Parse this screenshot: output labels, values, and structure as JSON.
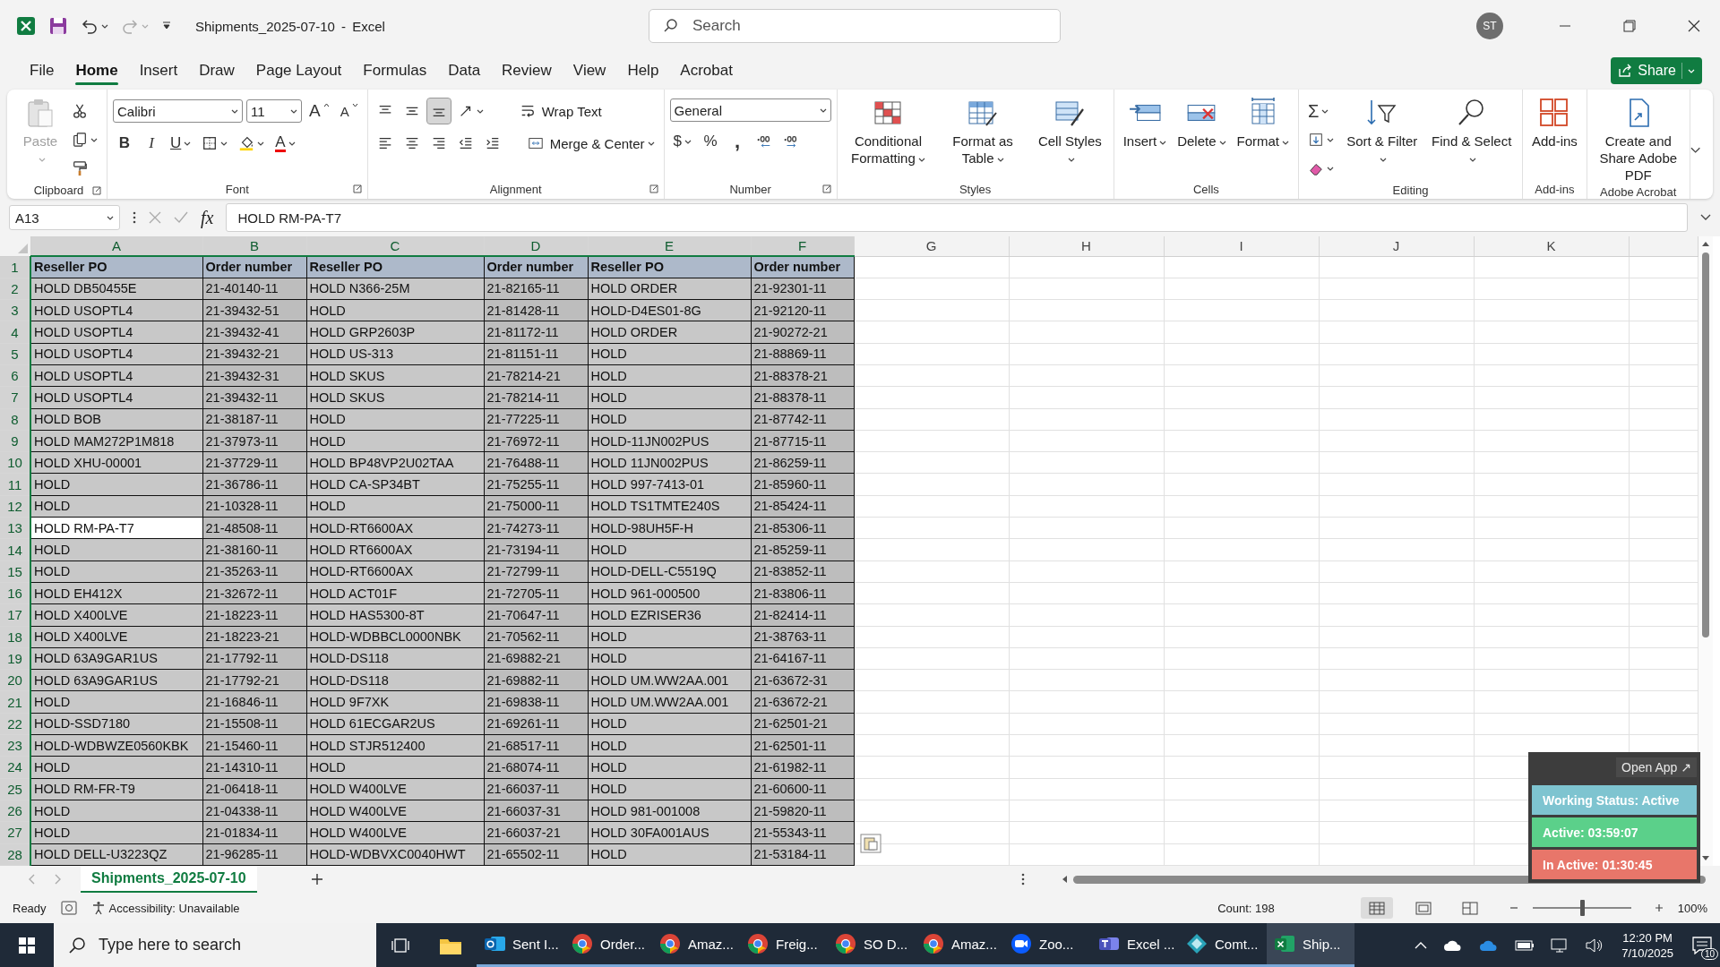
{
  "window": {
    "title": "Shipments_2025-07-10 - Excel",
    "search_placeholder": "Search",
    "avatar": "ST"
  },
  "menu_tabs": [
    {
      "label": "File",
      "selected": false
    },
    {
      "label": "Home",
      "selected": true
    },
    {
      "label": "Insert",
      "selected": false
    },
    {
      "label": "Draw",
      "selected": false
    },
    {
      "label": "Page Layout",
      "selected": false
    },
    {
      "label": "Formulas",
      "selected": false
    },
    {
      "label": "Data",
      "selected": false
    },
    {
      "label": "Review",
      "selected": false
    },
    {
      "label": "View",
      "selected": false
    },
    {
      "label": "Help",
      "selected": false
    },
    {
      "label": "Acrobat",
      "selected": false
    }
  ],
  "share_button": "Share",
  "ribbon": {
    "groups": [
      {
        "label": "Clipboard",
        "launcher": true,
        "items": [
          {
            "kind": "paste",
            "label": "Paste",
            "caret": true,
            "disabled": true
          },
          {
            "kind": "stack",
            "lines": [
              [
                {
                  "kind": "cut",
                  "caret": false
                }
              ],
              [
                {
                  "kind": "copy",
                  "caret": true
                }
              ],
              [
                {
                  "kind": "painter",
                  "caret": false
                }
              ]
            ]
          }
        ]
      },
      {
        "label": "Font",
        "launcher": true,
        "items": [
          {
            "kind": "stack",
            "lines": [
              [
                {
                  "kind": "fontname",
                  "value": "Calibri"
                },
                {
                  "kind": "fontsize",
                  "value": "11"
                },
                {
                  "kind": "grow",
                  "text": "A",
                  "caret": false
                },
                {
                  "kind": "shrink",
                  "text": "A",
                  "caret": false
                }
              ],
              [
                {
                  "kind": "bold",
                  "text": "B",
                  "caret": false
                },
                {
                  "kind": "italic",
                  "text": "I",
                  "caret": false
                },
                {
                  "kind": "underline",
                  "text": "U",
                  "caret": true
                },
                {
                  "kind": "borders",
                  "caret": true
                },
                {
                  "kind": "fill",
                  "caret": true
                },
                {
                  "kind": "fontcolor",
                  "text": "A",
                  "caret": true
                }
              ]
            ]
          }
        ]
      },
      {
        "label": "Alignment",
        "launcher": true,
        "items": [
          {
            "kind": "stack",
            "lines": [
              [
                {
                  "kind": "aligntop",
                  "caret": false,
                  "selected": false
                },
                {
                  "kind": "alignmiddle",
                  "caret": false,
                  "selected": false
                },
                {
                  "kind": "alignbottom",
                  "caret": false,
                  "selected": true
                },
                {
                  "kind": "orientation",
                  "caret": true,
                  "selected": false
                },
                {
                  "kind": "wrap",
                  "label": "Wrap Text",
                  "caret": false,
                  "selected": false
                }
              ],
              [
                {
                  "kind": "alignleft",
                  "caret": false,
                  "selected": false
                },
                {
                  "kind": "aligncenter",
                  "caret": false,
                  "selected": false
                },
                {
                  "kind": "alignright",
                  "caret": false,
                  "selected": false
                },
                {
                  "kind": "outdent",
                  "caret": false,
                  "selected": false
                },
                {
                  "kind": "indent",
                  "caret": false,
                  "selected": false
                },
                {
                  "kind": "merge",
                  "label": "Merge & Center",
                  "caret": true,
                  "selected": false
                }
              ]
            ]
          }
        ]
      },
      {
        "label": "Number",
        "launcher": true,
        "items": [
          {
            "kind": "stack",
            "lines": [
              [
                {
                  "kind": "numberformat",
                  "value": "General"
                }
              ],
              [
                {
                  "kind": "currency",
                  "text": "$",
                  "caret": true
                },
                {
                  "kind": "percent",
                  "text": "%",
                  "caret": false
                },
                {
                  "kind": "comma",
                  "text": ",",
                  "caret": false
                },
                {
                  "kind": "incdecimal",
                  "caret": false
                },
                {
                  "kind": "decdecimal",
                  "caret": false
                }
              ]
            ]
          }
        ]
      },
      {
        "label": "Styles",
        "launcher": false,
        "items": [
          {
            "kind": "conditional",
            "label": "Conditional Formatting",
            "caret": true,
            "disabled": false
          },
          {
            "kind": "table",
            "label": "Format as Table",
            "caret": true,
            "disabled": false
          },
          {
            "kind": "styles",
            "label": "Cell Styles",
            "caret": true,
            "disabled": false
          }
        ]
      },
      {
        "label": "Cells",
        "launcher": false,
        "items": [
          {
            "kind": "insert",
            "label": "Insert",
            "caret": true,
            "disabled": false
          },
          {
            "kind": "delete",
            "label": "Delete",
            "caret": true,
            "disabled": false
          },
          {
            "kind": "format",
            "label": "Format",
            "caret": true,
            "disabled": false
          }
        ]
      },
      {
        "label": "Editing",
        "launcher": false,
        "items": [
          {
            "kind": "stack",
            "lines": [
              [
                {
                  "kind": "sum",
                  "text": "Σ",
                  "caret": true
                }
              ],
              [
                {
                  "kind": "filldown",
                  "caret": true
                }
              ],
              [
                {
                  "kind": "clear",
                  "caret": true
                }
              ]
            ]
          },
          {
            "kind": "sort",
            "label": "Sort & Filter",
            "caret": true,
            "disabled": false
          },
          {
            "kind": "find",
            "label": "Find & Select",
            "caret": true,
            "disabled": false
          }
        ]
      },
      {
        "label": "Add-ins",
        "launcher": false,
        "items": [
          {
            "kind": "addins",
            "label": "Add-ins",
            "caret": false,
            "disabled": false
          }
        ]
      },
      {
        "label": "Adobe Acrobat",
        "launcher": false,
        "items": [
          {
            "kind": "pdf",
            "label": "Create and Share Adobe PDF",
            "caret": false,
            "disabled": false
          }
        ]
      }
    ]
  },
  "formula_bar": {
    "cell_reference": "A13",
    "function_label": "fx",
    "formula": "HOLD RM-PA-T7"
  },
  "columns": [
    {
      "letter": "A",
      "selected": true
    },
    {
      "letter": "B",
      "selected": true
    },
    {
      "letter": "C",
      "selected": true
    },
    {
      "letter": "D",
      "selected": true
    },
    {
      "letter": "E",
      "selected": true
    },
    {
      "letter": "F",
      "selected": true
    },
    {
      "letter": "G",
      "selected": false
    },
    {
      "letter": "H",
      "selected": false
    },
    {
      "letter": "I",
      "selected": false
    },
    {
      "letter": "J",
      "selected": false
    },
    {
      "letter": "K",
      "selected": false
    }
  ],
  "rows": [
    {
      "number": "1",
      "selected": true,
      "kind": "header",
      "cells": [
        {
          "text": "Reseller PO",
          "active": false
        },
        {
          "text": "Order number",
          "active": false
        },
        {
          "text": "Reseller PO",
          "active": false
        },
        {
          "text": "Order number",
          "active": false
        },
        {
          "text": "Reseller PO",
          "active": false
        },
        {
          "text": "Order number",
          "active": false
        }
      ]
    },
    {
      "number": "2",
      "selected": true,
      "kind": "data",
      "cells": [
        {
          "text": "HOLD DB50455E",
          "active": false
        },
        {
          "text": "21-40140-11",
          "active": false
        },
        {
          "text": "HOLD N366-25M",
          "active": false
        },
        {
          "text": "21-82165-11",
          "active": false
        },
        {
          "text": "HOLD ORDER",
          "active": false
        },
        {
          "text": "21-92301-11",
          "active": false
        }
      ]
    },
    {
      "number": "3",
      "selected": true,
      "kind": "data",
      "cells": [
        {
          "text": "HOLD USOPTL4",
          "active": false
        },
        {
          "text": "21-39432-51",
          "active": false
        },
        {
          "text": "HOLD",
          "active": false
        },
        {
          "text": "21-81428-11",
          "active": false
        },
        {
          "text": "HOLD-D4ES01-8G",
          "active": false
        },
        {
          "text": "21-92120-11",
          "active": false
        }
      ]
    },
    {
      "number": "4",
      "selected": true,
      "kind": "data",
      "cells": [
        {
          "text": "HOLD USOPTL4",
          "active": false
        },
        {
          "text": "21-39432-41",
          "active": false
        },
        {
          "text": "HOLD GRP2603P",
          "active": false
        },
        {
          "text": "21-81172-11",
          "active": false
        },
        {
          "text": "HOLD ORDER",
          "active": false
        },
        {
          "text": "21-90272-21",
          "active": false
        }
      ]
    },
    {
      "number": "5",
      "selected": true,
      "kind": "data",
      "cells": [
        {
          "text": "HOLD USOPTL4",
          "active": false
        },
        {
          "text": "21-39432-21",
          "active": false
        },
        {
          "text": "HOLD US-313",
          "active": false
        },
        {
          "text": "21-81151-11",
          "active": false
        },
        {
          "text": "HOLD",
          "active": false
        },
        {
          "text": "21-88869-11",
          "active": false
        }
      ]
    },
    {
      "number": "6",
      "selected": true,
      "kind": "data",
      "cells": [
        {
          "text": "HOLD USOPTL4",
          "active": false
        },
        {
          "text": "21-39432-31",
          "active": false
        },
        {
          "text": "HOLD SKUS",
          "active": false
        },
        {
          "text": "21-78214-21",
          "active": false
        },
        {
          "text": "HOLD",
          "active": false
        },
        {
          "text": "21-88378-21",
          "active": false
        }
      ]
    },
    {
      "number": "7",
      "selected": true,
      "kind": "data",
      "cells": [
        {
          "text": "HOLD USOPTL4",
          "active": false
        },
        {
          "text": "21-39432-11",
          "active": false
        },
        {
          "text": "HOLD SKUS",
          "active": false
        },
        {
          "text": "21-78214-11",
          "active": false
        },
        {
          "text": "HOLD",
          "active": false
        },
        {
          "text": "21-88378-11",
          "active": false
        }
      ]
    },
    {
      "number": "8",
      "selected": true,
      "kind": "data",
      "cells": [
        {
          "text": "HOLD BOB",
          "active": false
        },
        {
          "text": "21-38187-11",
          "active": false
        },
        {
          "text": "HOLD",
          "active": false
        },
        {
          "text": "21-77225-11",
          "active": false
        },
        {
          "text": "HOLD",
          "active": false
        },
        {
          "text": "21-87742-11",
          "active": false
        }
      ]
    },
    {
      "number": "9",
      "selected": true,
      "kind": "data",
      "cells": [
        {
          "text": "HOLD MAM272P1M818",
          "active": false
        },
        {
          "text": "21-37973-11",
          "active": false
        },
        {
          "text": "HOLD",
          "active": false
        },
        {
          "text": "21-76972-11",
          "active": false
        },
        {
          "text": "HOLD-11JN002PUS",
          "active": false
        },
        {
          "text": "21-87715-11",
          "active": false
        }
      ]
    },
    {
      "number": "10",
      "selected": true,
      "kind": "data",
      "cells": [
        {
          "text": "HOLD XHU-00001",
          "active": false
        },
        {
          "text": "21-37729-11",
          "active": false
        },
        {
          "text": "HOLD BP48VP2U02TAA",
          "active": false
        },
        {
          "text": "21-76488-11",
          "active": false
        },
        {
          "text": "HOLD 11JN002PUS",
          "active": false
        },
        {
          "text": "21-86259-11",
          "active": false
        }
      ]
    },
    {
      "number": "11",
      "selected": true,
      "kind": "data",
      "cells": [
        {
          "text": "HOLD",
          "active": false
        },
        {
          "text": "21-36786-11",
          "active": false
        },
        {
          "text": "HOLD CA-SP34BT",
          "active": false
        },
        {
          "text": "21-75255-11",
          "active": false
        },
        {
          "text": "HOLD 997-7413-01",
          "active": false
        },
        {
          "text": "21-85960-11",
          "active": false
        }
      ]
    },
    {
      "number": "12",
      "selected": true,
      "kind": "data",
      "cells": [
        {
          "text": "HOLD",
          "active": false
        },
        {
          "text": "21-10328-11",
          "active": false
        },
        {
          "text": "HOLD",
          "active": false
        },
        {
          "text": "21-75000-11",
          "active": false
        },
        {
          "text": "HOLD TS1TMTE240S",
          "active": false
        },
        {
          "text": "21-85424-11",
          "active": false
        }
      ]
    },
    {
      "number": "13",
      "selected": true,
      "kind": "data",
      "cells": [
        {
          "text": "HOLD RM-PA-T7",
          "active": true
        },
        {
          "text": "21-48508-11",
          "active": false
        },
        {
          "text": "HOLD-RT6600AX",
          "active": false
        },
        {
          "text": "21-74273-11",
          "active": false
        },
        {
          "text": "HOLD-98UH5F-H",
          "active": false
        },
        {
          "text": "21-85306-11",
          "active": false
        }
      ]
    },
    {
      "number": "14",
      "selected": true,
      "kind": "data",
      "cells": [
        {
          "text": "HOLD",
          "active": false
        },
        {
          "text": "21-38160-11",
          "active": false
        },
        {
          "text": "HOLD RT6600AX",
          "active": false
        },
        {
          "text": "21-73194-11",
          "active": false
        },
        {
          "text": "HOLD",
          "active": false
        },
        {
          "text": "21-85259-11",
          "active": false
        }
      ]
    },
    {
      "number": "15",
      "selected": true,
      "kind": "data",
      "cells": [
        {
          "text": "HOLD",
          "active": false
        },
        {
          "text": "21-35263-11",
          "active": false
        },
        {
          "text": "HOLD-RT6600AX",
          "active": false
        },
        {
          "text": "21-72799-11",
          "active": false
        },
        {
          "text": "HOLD-DELL-C5519Q",
          "active": false
        },
        {
          "text": "21-83852-11",
          "active": false
        }
      ]
    },
    {
      "number": "16",
      "selected": true,
      "kind": "data",
      "cells": [
        {
          "text": "HOLD EH412X",
          "active": false
        },
        {
          "text": "21-32672-11",
          "active": false
        },
        {
          "text": "HOLD ACT01F",
          "active": false
        },
        {
          "text": "21-72705-11",
          "active": false
        },
        {
          "text": "HOLD 961-000500",
          "active": false
        },
        {
          "text": "21-83806-11",
          "active": false
        }
      ]
    },
    {
      "number": "17",
      "selected": true,
      "kind": "data",
      "cells": [
        {
          "text": "HOLD X400LVE",
          "active": false
        },
        {
          "text": "21-18223-11",
          "active": false
        },
        {
          "text": "HOLD HAS5300-8T",
          "active": false
        },
        {
          "text": "21-70647-11",
          "active": false
        },
        {
          "text": "HOLD EZRISER36",
          "active": false
        },
        {
          "text": "21-82414-11",
          "active": false
        }
      ]
    },
    {
      "number": "18",
      "selected": true,
      "kind": "data",
      "cells": [
        {
          "text": "HOLD X400LVE",
          "active": false
        },
        {
          "text": "21-18223-21",
          "active": false
        },
        {
          "text": "HOLD-WDBBCL0000NBK",
          "active": false
        },
        {
          "text": "21-70562-11",
          "active": false
        },
        {
          "text": "HOLD",
          "active": false
        },
        {
          "text": "21-38763-11",
          "active": false
        }
      ]
    },
    {
      "number": "19",
      "selected": true,
      "kind": "data",
      "cells": [
        {
          "text": "HOLD 63A9GAR1US",
          "active": false
        },
        {
          "text": "21-17792-11",
          "active": false
        },
        {
          "text": "HOLD-DS118",
          "active": false
        },
        {
          "text": "21-69882-21",
          "active": false
        },
        {
          "text": "HOLD",
          "active": false
        },
        {
          "text": "21-64167-11",
          "active": false
        }
      ]
    },
    {
      "number": "20",
      "selected": true,
      "kind": "data",
      "cells": [
        {
          "text": "HOLD 63A9GAR1US",
          "active": false
        },
        {
          "text": "21-17792-21",
          "active": false
        },
        {
          "text": "HOLD-DS118",
          "active": false
        },
        {
          "text": "21-69882-11",
          "active": false
        },
        {
          "text": "HOLD UM.WW2AA.001",
          "active": false
        },
        {
          "text": "21-63672-31",
          "active": false
        }
      ]
    },
    {
      "number": "21",
      "selected": true,
      "kind": "data",
      "cells": [
        {
          "text": "HOLD",
          "active": false
        },
        {
          "text": "21-16846-11",
          "active": false
        },
        {
          "text": "HOLD 9F7XK",
          "active": false
        },
        {
          "text": "21-69838-11",
          "active": false
        },
        {
          "text": "HOLD UM.WW2AA.001",
          "active": false
        },
        {
          "text": "21-63672-21",
          "active": false
        }
      ]
    },
    {
      "number": "22",
      "selected": true,
      "kind": "data",
      "cells": [
        {
          "text": "HOLD-SSD7180",
          "active": false
        },
        {
          "text": "21-15508-11",
          "active": false
        },
        {
          "text": "HOLD 61ECGAR2US",
          "active": false
        },
        {
          "text": "21-69261-11",
          "active": false
        },
        {
          "text": "HOLD",
          "active": false
        },
        {
          "text": "21-62501-21",
          "active": false
        }
      ]
    },
    {
      "number": "23",
      "selected": true,
      "kind": "data",
      "cells": [
        {
          "text": "HOLD-WDBWZE0560KBK",
          "active": false
        },
        {
          "text": "21-15460-11",
          "active": false
        },
        {
          "text": "HOLD STJR512400",
          "active": false
        },
        {
          "text": "21-68517-11",
          "active": false
        },
        {
          "text": "HOLD",
          "active": false
        },
        {
          "text": "21-62501-11",
          "active": false
        }
      ]
    },
    {
      "number": "24",
      "selected": true,
      "kind": "data",
      "cells": [
        {
          "text": "HOLD",
          "active": false
        },
        {
          "text": "21-14310-11",
          "active": false
        },
        {
          "text": "HOLD",
          "active": false
        },
        {
          "text": "21-68074-11",
          "active": false
        },
        {
          "text": "HOLD",
          "active": false
        },
        {
          "text": "21-61982-11",
          "active": false
        }
      ]
    },
    {
      "number": "25",
      "selected": true,
      "kind": "data",
      "cells": [
        {
          "text": "HOLD RM-FR-T9",
          "active": false
        },
        {
          "text": "21-06418-11",
          "active": false
        },
        {
          "text": "HOLD W400LVE",
          "active": false
        },
        {
          "text": "21-66037-11",
          "active": false
        },
        {
          "text": "HOLD",
          "active": false
        },
        {
          "text": "21-60600-11",
          "active": false
        }
      ]
    },
    {
      "number": "26",
      "selected": true,
      "kind": "data",
      "cells": [
        {
          "text": "HOLD",
          "active": false
        },
        {
          "text": "21-04338-11",
          "active": false
        },
        {
          "text": "HOLD W400LVE",
          "active": false
        },
        {
          "text": "21-66037-31",
          "active": false
        },
        {
          "text": "HOLD 981-001008",
          "active": false
        },
        {
          "text": "21-59820-11",
          "active": false
        }
      ]
    },
    {
      "number": "27",
      "selected": true,
      "kind": "data",
      "cells": [
        {
          "text": "HOLD",
          "active": false
        },
        {
          "text": "21-01834-11",
          "active": false
        },
        {
          "text": "HOLD W400LVE",
          "active": false
        },
        {
          "text": "21-66037-21",
          "active": false
        },
        {
          "text": "HOLD 30FA001AUS",
          "active": false
        },
        {
          "text": "21-55343-11",
          "active": false
        }
      ]
    },
    {
      "number": "28",
      "selected": true,
      "kind": "data",
      "cells": [
        {
          "text": "HOLD DELL-U3223QZ",
          "active": false
        },
        {
          "text": "21-96285-11",
          "active": false
        },
        {
          "text": "HOLD-WDBVXC0040HWT",
          "active": false
        },
        {
          "text": "21-65502-11",
          "active": false
        },
        {
          "text": "HOLD",
          "active": false
        },
        {
          "text": "21-53184-11",
          "active": false
        }
      ]
    }
  ],
  "sheet_tabs": [
    {
      "label": "Shipments_2025-07-10",
      "selected": true
    }
  ],
  "status_bar": {
    "state": "Ready",
    "accessibility": "Accessibility: Unavailable",
    "count": "Count: 198",
    "views": [
      {
        "kind": "normal",
        "selected": true
      },
      {
        "kind": "pagelayout",
        "selected": false
      },
      {
        "kind": "pagebreak",
        "selected": false
      }
    ],
    "zoom": {
      "level": 0.5,
      "reading": "100%"
    }
  },
  "tracker": {
    "open_app": "Open App ↗",
    "items": [
      {
        "text": "Working Status: Active",
        "color": "#7ec4d0"
      },
      {
        "text": "Active: 03:59:07",
        "color": "#5bd08a"
      },
      {
        "text": "In Active: 01:30:45",
        "color": "#e8766a"
      }
    ]
  },
  "taskbar": {
    "search_placeholder": "Type here to search",
    "apps": [
      {
        "kind": "outlook",
        "label": "Sent I...",
        "selected": false
      },
      {
        "kind": "chrome",
        "label": "Order...",
        "selected": false
      },
      {
        "kind": "chrome",
        "label": "Amaz...",
        "selected": false
      },
      {
        "kind": "chrome",
        "label": "Freig...",
        "selected": false
      },
      {
        "kind": "chrome",
        "label": "SO D...",
        "selected": false
      },
      {
        "kind": "chrome",
        "label": "Amaz...",
        "selected": false
      },
      {
        "kind": "zoom",
        "label": "Zoo...",
        "selected": false
      },
      {
        "kind": "teams",
        "label": "Excel ...",
        "selected": false
      },
      {
        "kind": "diamond",
        "label": "Comt...",
        "selected": false
      },
      {
        "kind": "excel",
        "label": "Ship...",
        "selected": true
      }
    ],
    "time": "12:20 PM",
    "date": "7/10/2025",
    "notifications": "10"
  }
}
